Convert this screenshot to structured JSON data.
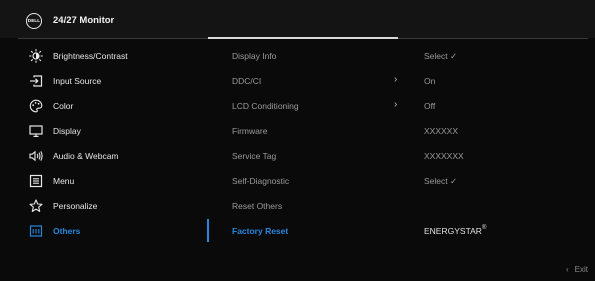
{
  "header": {
    "logo_text": "DELL",
    "title": "24/27 Monitor"
  },
  "sidebar": {
    "items": [
      {
        "label": "Brightness/Contrast",
        "icon": "brightness-icon"
      },
      {
        "label": "Input Source",
        "icon": "input-source-icon"
      },
      {
        "label": "Color",
        "icon": "color-palette-icon"
      },
      {
        "label": "Display",
        "icon": "display-icon"
      },
      {
        "label": "Audio & Webcam",
        "icon": "audio-webcam-icon"
      },
      {
        "label": "Menu",
        "icon": "menu-icon"
      },
      {
        "label": "Personalize",
        "icon": "star-icon"
      },
      {
        "label": "Others",
        "icon": "others-icon"
      }
    ],
    "selected": "Others"
  },
  "main": {
    "rows": [
      {
        "label": "Display Info",
        "value": "Select ✓"
      },
      {
        "label": "DDC/CI",
        "value": "On",
        "arrow": "›"
      },
      {
        "label": "LCD Conditioning",
        "value": "Off",
        "arrow": "›"
      },
      {
        "label": "Firmware",
        "value": "XXXXXX"
      },
      {
        "label": "Service Tag",
        "value": "XXXXXXX"
      },
      {
        "label": "Self-Diagnostic",
        "value": "Select ✓"
      },
      {
        "label": "Reset Others",
        "value": ""
      },
      {
        "label": "Factory Reset",
        "value": "ENERGYSTAR",
        "value_mark": "®"
      }
    ],
    "selected": "Factory Reset"
  },
  "footer": {
    "exit_chevron": "‹",
    "exit_label": "Exit"
  },
  "colors": {
    "accent": "#2a86dd",
    "background": "#0a0a0a",
    "header": "#141414"
  }
}
